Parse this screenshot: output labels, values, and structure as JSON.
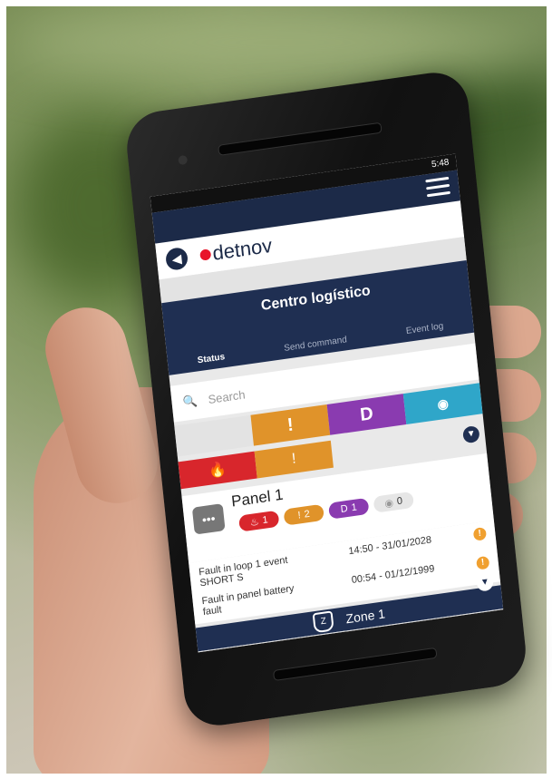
{
  "status_bar": {
    "time": "5:48"
  },
  "app": {
    "brand": "detnov",
    "site_title": "Centro logístico",
    "tabs": [
      {
        "label": "Status"
      },
      {
        "label": "Send command"
      },
      {
        "label": "Event log"
      }
    ],
    "search_placeholder": "Search"
  },
  "filters": {
    "top": [
      {
        "label": "!",
        "color": "#e0932a"
      },
      {
        "label": "D",
        "color": "#8a3bb0"
      },
      {
        "label": "",
        "icon": "detector-icon",
        "color": "#2fa6c9"
      }
    ],
    "bottom": [
      {
        "label": "",
        "icon": "fire-icon",
        "color": "#d8262c"
      },
      {
        "label": "!",
        "color": "#e0932a"
      }
    ]
  },
  "panel": {
    "name": "Panel 1",
    "badges": [
      {
        "label": "1",
        "icon": "fire-icon",
        "color": "#d8262c"
      },
      {
        "label": "2",
        "icon": "warning-icon",
        "color": "#e0932a"
      },
      {
        "label": "1",
        "prefix": "D",
        "color": "#8a3bb0"
      },
      {
        "label": "0",
        "icon": "detector-icon",
        "color": "#e6e6e6"
      }
    ]
  },
  "events": [
    {
      "text": "Fault in loop 1 event SHORT S",
      "time": "14:50 - 31/01/2028"
    },
    {
      "text": "Fault in panel battery fault",
      "time": "00:54 - 01/12/1999"
    }
  ],
  "zone": {
    "label": "Zone 1",
    "icon_letter": "Z"
  },
  "colors": {
    "navy": "#1f2f52",
    "red": "#d8262c",
    "orange": "#e0932a",
    "purple": "#8a3bb0",
    "cyan": "#2fa6c9",
    "green": "#3fa844"
  }
}
